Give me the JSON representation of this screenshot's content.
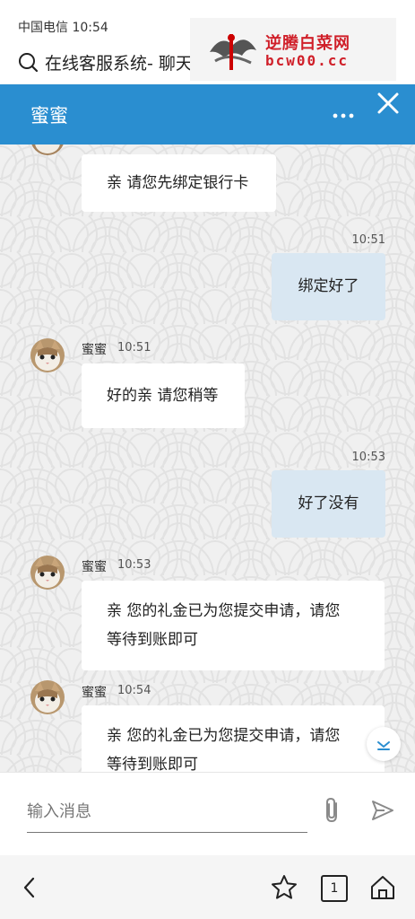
{
  "status_bar": {
    "carrier_time": "中国电信 10:54"
  },
  "url_bar": {
    "title": "在线客服系统- 聊天"
  },
  "watermark": {
    "line1": "逆腾白菜网",
    "line2": "bcw00.cc"
  },
  "header": {
    "title": "蜜蜜"
  },
  "messages": [
    {
      "side": "left",
      "text": "亲 请您先绑定银行卡"
    },
    {
      "side": "right",
      "time": "10:51",
      "text": "绑定好了"
    },
    {
      "side": "left",
      "sender": "蜜蜜",
      "time": "10:51",
      "text": "好的亲 请您稍等"
    },
    {
      "side": "right",
      "time": "10:53",
      "text": "好了没有"
    },
    {
      "side": "left",
      "sender": "蜜蜜",
      "time": "10:53",
      "lines": [
        "亲 您的礼金已为您提交申请，请您",
        "等待到账即可"
      ]
    },
    {
      "side": "left",
      "sender": "蜜蜜",
      "time": "10:54",
      "lines": [
        "亲 您的礼金已为您提交申请，请您",
        "等待到账即可"
      ]
    }
  ],
  "input": {
    "placeholder": "输入消息"
  },
  "bottom_nav": {
    "tab_count": "1"
  },
  "colors": {
    "header": "#2a8ed0",
    "bubble_self": "#d9e7f2",
    "chat_bg": "#f0f0f0"
  },
  "icons": [
    "search-icon",
    "more-icon",
    "close-icon",
    "chevron-down-icon",
    "paperclip-icon",
    "send-icon",
    "back-icon",
    "star-icon",
    "tabs-icon",
    "home-icon"
  ]
}
